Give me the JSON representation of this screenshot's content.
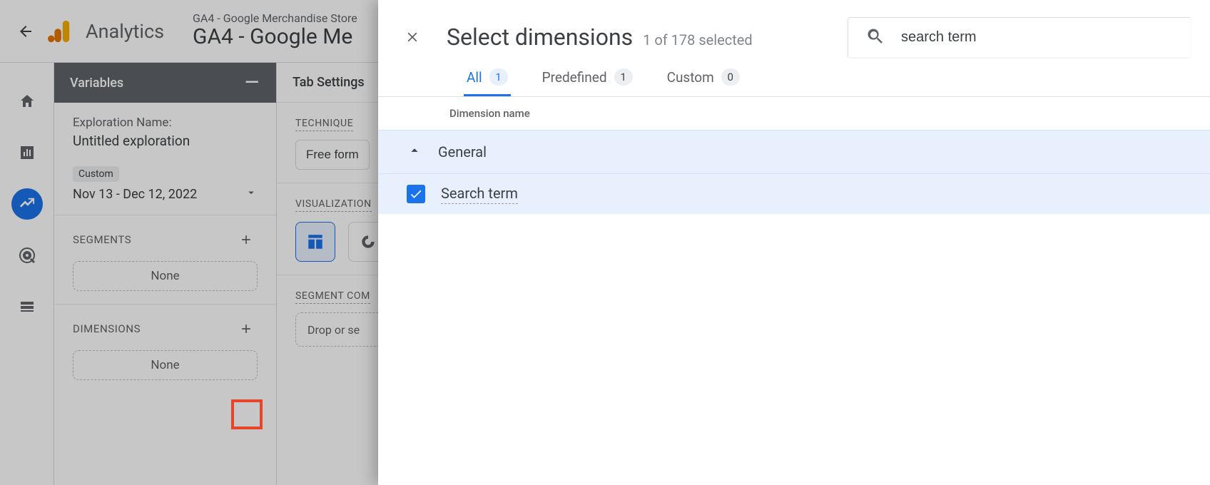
{
  "header": {
    "app_name": "Analytics",
    "breadcrumb_top": "GA4 - Google Merchandise Store",
    "breadcrumb_main": "GA4 - Google Me"
  },
  "variables": {
    "panel_title": "Variables",
    "exploration_label": "Exploration Name:",
    "exploration_name": "Untitled exploration",
    "date_chip": "Custom",
    "date_range": "Nov 13 - Dec 12, 2022",
    "segments_title": "SEGMENTS",
    "segments_none": "None",
    "dimensions_title": "DIMENSIONS",
    "dimensions_none": "None"
  },
  "tabsettings": {
    "panel_title": "Tab Settings",
    "technique_label": "TECHNIQUE",
    "technique_value": "Free form",
    "visualization_label": "VISUALIZATION",
    "segment_compare_label": "SEGMENT COM",
    "drop_text": "Drop or se"
  },
  "dialog": {
    "title": "Select dimensions",
    "subtitle": "1 of 178 selected",
    "search_value": "search term",
    "tabs": {
      "all_label": "All",
      "all_count": "1",
      "predefined_label": "Predefined",
      "predefined_count": "1",
      "custom_label": "Custom",
      "custom_count": "0"
    },
    "column_header": "Dimension name",
    "group_name": "General",
    "item_name": "Search term"
  }
}
